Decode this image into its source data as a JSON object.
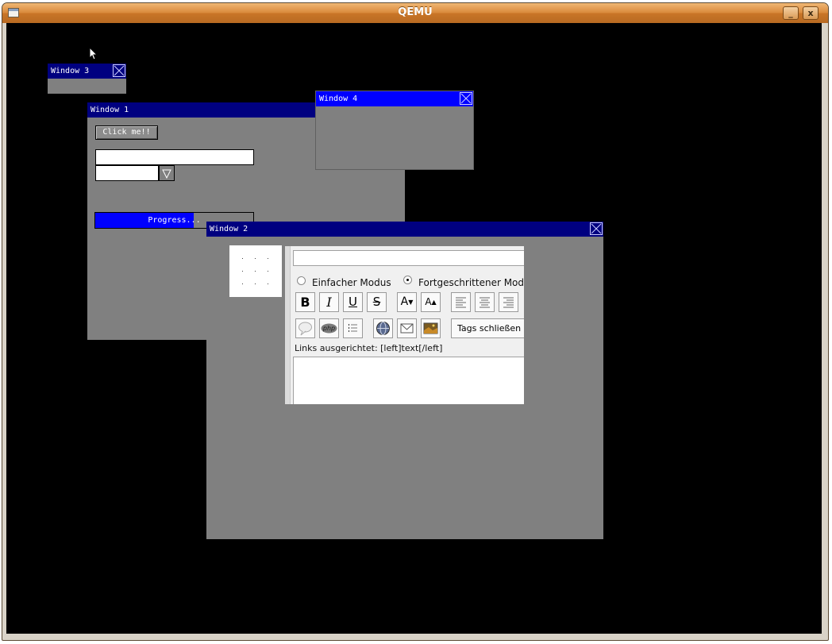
{
  "app": {
    "window_title": "QEMU",
    "minimize_symbol": "_",
    "close_symbol": "x"
  },
  "colors": {
    "desktop": "#000000",
    "window_body": "#808080",
    "active_title": "#0000ff",
    "inactive_title": "#000080"
  },
  "guest": {
    "window3": {
      "title": "Window 3"
    },
    "window4": {
      "title": "Window 4"
    },
    "window1": {
      "title": "Window 1",
      "button_label": "Click me!!",
      "text_input_value": "",
      "combo_value": "",
      "progress_label": "Progress...",
      "progress_fraction": 0.625
    },
    "window2": {
      "title": "Window 2",
      "editor": {
        "subject_value": "",
        "mode_simple": "Einfacher Modus",
        "mode_advanced": "Fortgeschrittener Modus",
        "selected_mode": "advanced",
        "toolbar_row1": [
          {
            "name": "bold-button",
            "label": "B"
          },
          {
            "name": "italic-button",
            "label": "I"
          },
          {
            "name": "underline-button",
            "label": "U"
          },
          {
            "name": "strikethrough-button",
            "label": "S"
          },
          {
            "name": "font-size-decrease-button",
            "label": "A"
          },
          {
            "name": "font-size-increase-button",
            "label": "A"
          },
          {
            "name": "align-left-button",
            "icon": "align-left-icon"
          },
          {
            "name": "align-center-button",
            "icon": "align-center-icon"
          },
          {
            "name": "align-right-button",
            "icon": "align-right-icon"
          }
        ],
        "toolbar_row2": [
          {
            "name": "quote-button",
            "icon": "speech-bubble-icon"
          },
          {
            "name": "php-button",
            "label": "php"
          },
          {
            "name": "list-button",
            "icon": "list-icon"
          },
          {
            "name": "link-button",
            "icon": "globe-icon"
          },
          {
            "name": "email-button",
            "icon": "envelope-icon"
          },
          {
            "name": "image-button",
            "icon": "picture-icon"
          }
        ],
        "close_tags_label": "Tags schließen",
        "help_text": "Links ausgerichtet: [left]text[/left]",
        "message_value": ""
      }
    }
  }
}
